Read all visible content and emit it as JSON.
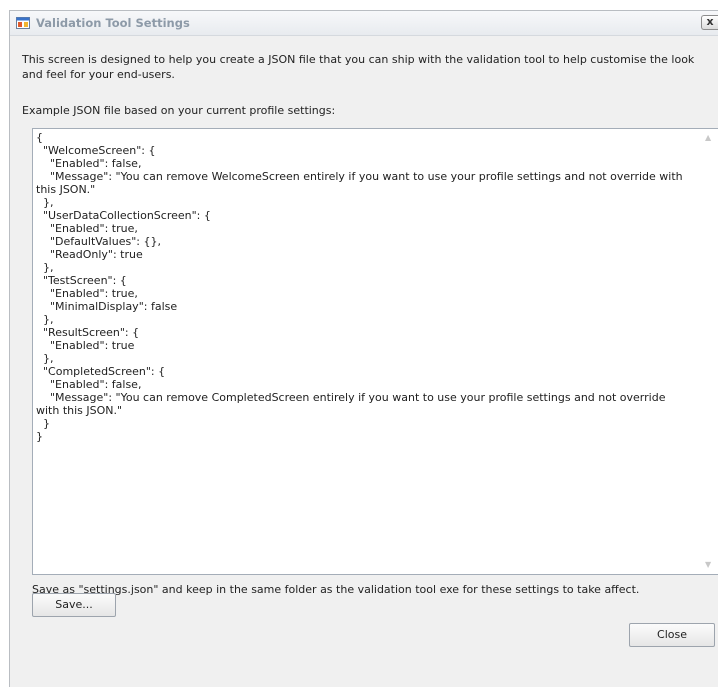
{
  "window": {
    "title": "Validation Tool Settings",
    "close_glyph": "x"
  },
  "intro_text": "This screen is designed to help you create a JSON file that you can ship with the validation tool to help customise the look and feel for your end-users.",
  "example_label": "Example JSON file based on your current profile settings:",
  "json_content": "{\n  \"WelcomeScreen\": {\n    \"Enabled\": false,\n    \"Message\": \"You can remove WelcomeScreen entirely if you want to use your profile settings and not override with this JSON.\"\n  },\n  \"UserDataCollectionScreen\": {\n    \"Enabled\": true,\n    \"DefaultValues\": {},\n    \"ReadOnly\": true\n  },\n  \"TestScreen\": {\n    \"Enabled\": true,\n    \"MinimalDisplay\": false\n  },\n  \"ResultScreen\": {\n    \"Enabled\": true\n  },\n  \"CompletedScreen\": {\n    \"Enabled\": false,\n    \"Message\": \"You can remove CompletedScreen entirely if you want to use your profile settings and not override with this JSON.\"\n  }\n}",
  "save_note": "Save as \"settings.json\" and keep in the same folder as the validation tool exe for these settings to take affect.",
  "buttons": {
    "save_label": "Save...",
    "close_label": "Close"
  },
  "icons": {
    "app": "app-window-icon",
    "scroll_up": "scroll-up-arrow-icon",
    "scroll_down": "scroll-down-arrow-icon"
  },
  "colors": {
    "title_text": "#8d9aa8",
    "dialog_background": "#f0f0f0",
    "textbox_border": "#a4adb8"
  }
}
